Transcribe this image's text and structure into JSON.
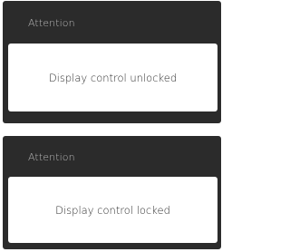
{
  "dialogs": [
    {
      "title": "Attention",
      "message": "Display control unlocked"
    },
    {
      "title": "Attention",
      "message": "Display control locked"
    }
  ],
  "colors": {
    "dialog_background": "#2b2b2b",
    "title_text": "#bdbdbd",
    "message_background": "#ffffff",
    "message_text": "#2b2b2b"
  }
}
